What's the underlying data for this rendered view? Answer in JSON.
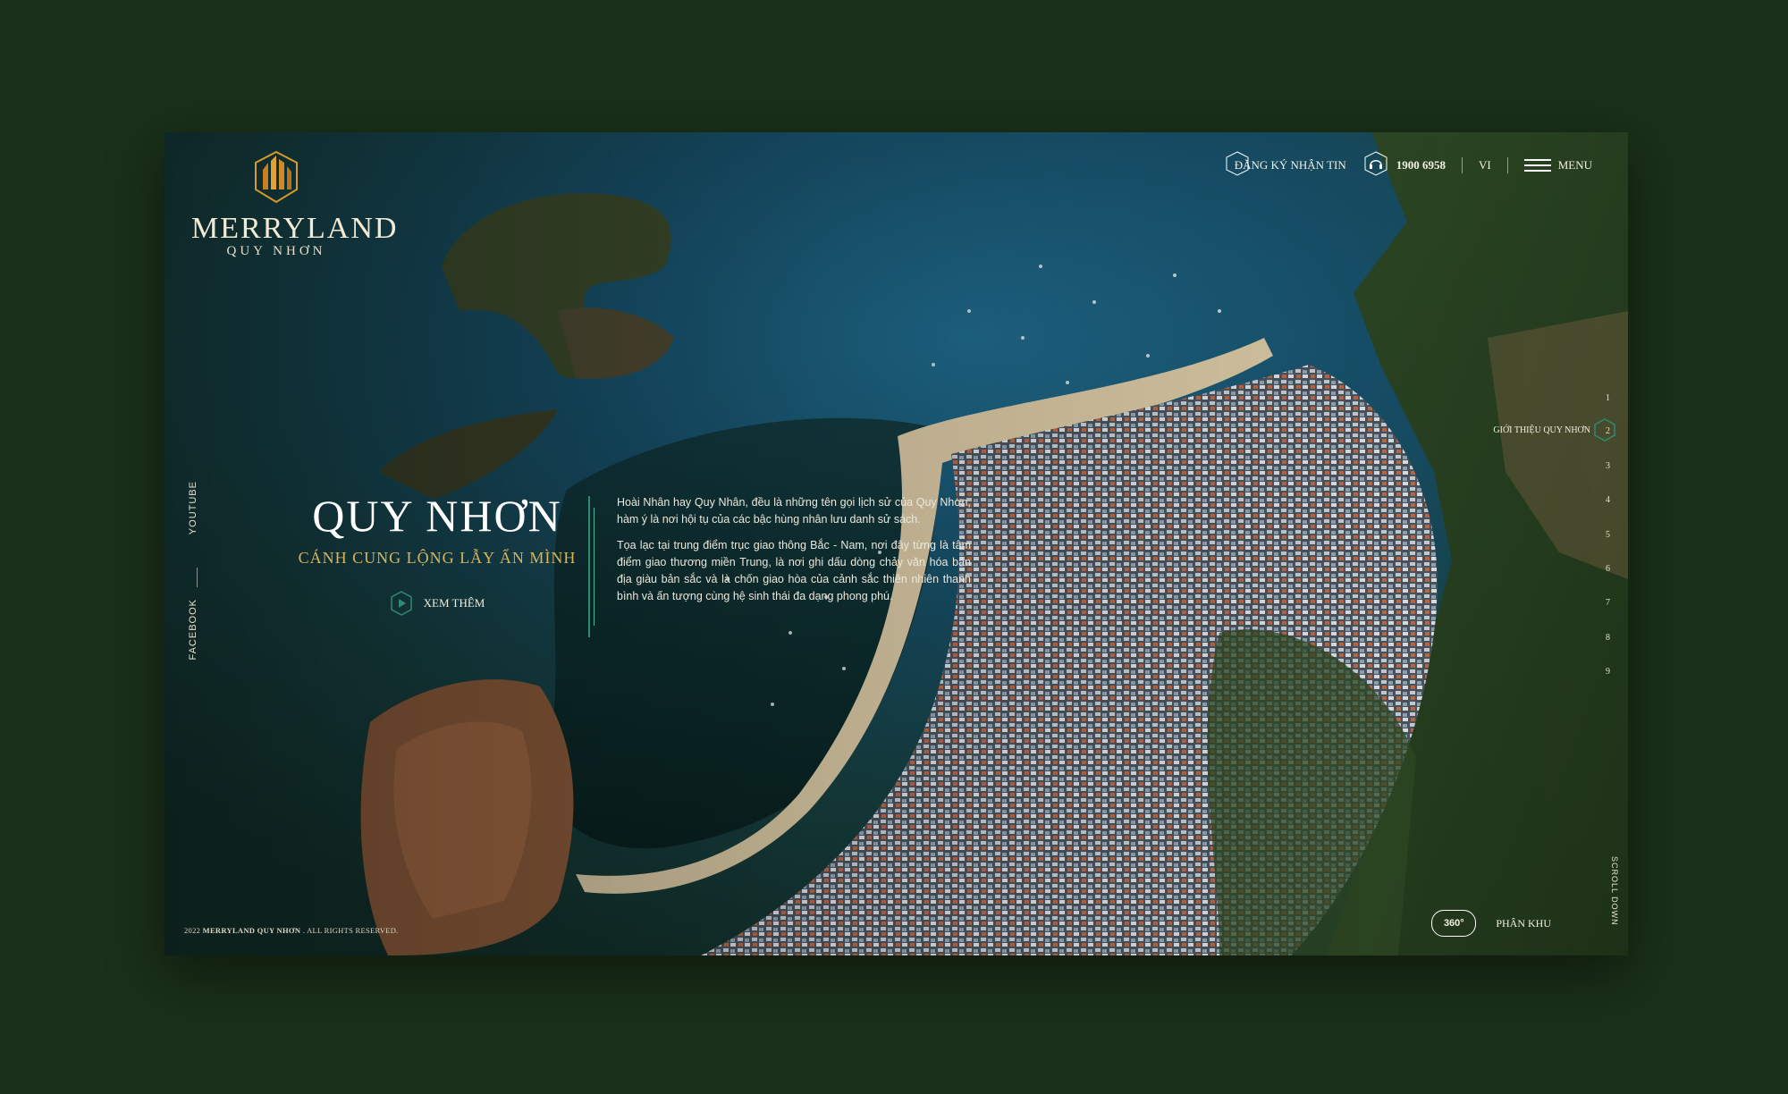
{
  "brand": {
    "name": "MERRYLAND",
    "sub": "QUY NHƠN"
  },
  "nav": {
    "subscribe": "ĐĂNG KÝ NHẬN TIN",
    "phone": "1900 6958",
    "lang": "VI",
    "menu": "MENU"
  },
  "social": {
    "youtube": "YOUTUBE",
    "facebook": "FACEBOOK"
  },
  "hero": {
    "title": "QUY NHƠN",
    "subtitle": "CÁNH CUNG LỘNG LẪY ẨN MÌNH",
    "more": "XEM THÊM"
  },
  "text": {
    "p1": "Hoài Nhân hay Quy Nhân, đều là những tên gọi lịch sử của Quy Nhơn, hàm ý là nơi hội tụ của các bậc hùng nhân lưu danh sử sách.",
    "p2": "Tọa lạc tại trung điểm trục giao thông Bắc - Nam, nơi đây từng là tâm điểm giao thương miền Trung, là nơi ghi dấu dòng chảy văn hóa bản địa giàu bản sắc và là chốn giao hòa của cảnh sắc thiên nhiên thanh bình và ấn tượng cùng hệ sinh thái đa dạng phong phú."
  },
  "pager": {
    "items": [
      "1",
      "2",
      "3",
      "4",
      "5",
      "6",
      "7",
      "8",
      "9"
    ],
    "active_label": "GIỚI THIỆU QUY NHƠN"
  },
  "scroll": "SCROLL DOWN",
  "bottom": {
    "btn360": "360°",
    "zones": "PHÂN KHU"
  },
  "copyright": {
    "year": "2022",
    "brand": "MERRYLAND QUY NHƠN",
    "rights": ". ALL RIGHTS RESERVED."
  },
  "colors": {
    "gold": "#d6b55d",
    "teal": "#2e8a70",
    "bg": "#1a3018"
  }
}
